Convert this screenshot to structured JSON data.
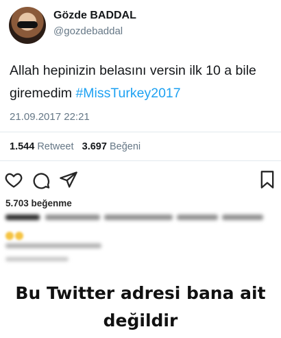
{
  "tweet": {
    "display_name": "Gözde BADDAL",
    "handle": "@gozdebaddal",
    "text_main": "Allah hepinizin belasını versin ilk 10 a bile giremedim ",
    "hashtag": "#MissTurkey2017",
    "timestamp": "21.09.2017 22:21",
    "retweet_count": "1.544",
    "retweet_label": "Retweet",
    "like_count": "3.697",
    "like_label": "Beğeni"
  },
  "instagram": {
    "likes_text": "5.703 beğenme",
    "icons": [
      "heart-icon",
      "comment-icon",
      "share-icon",
      "bookmark-icon"
    ]
  },
  "caption": {
    "line1": "Bu Twitter adresi bana ait",
    "line2": "değildir"
  },
  "colors": {
    "hashtag": "#1da1f2",
    "muted": "#657786",
    "divider": "#e1e8ed"
  }
}
